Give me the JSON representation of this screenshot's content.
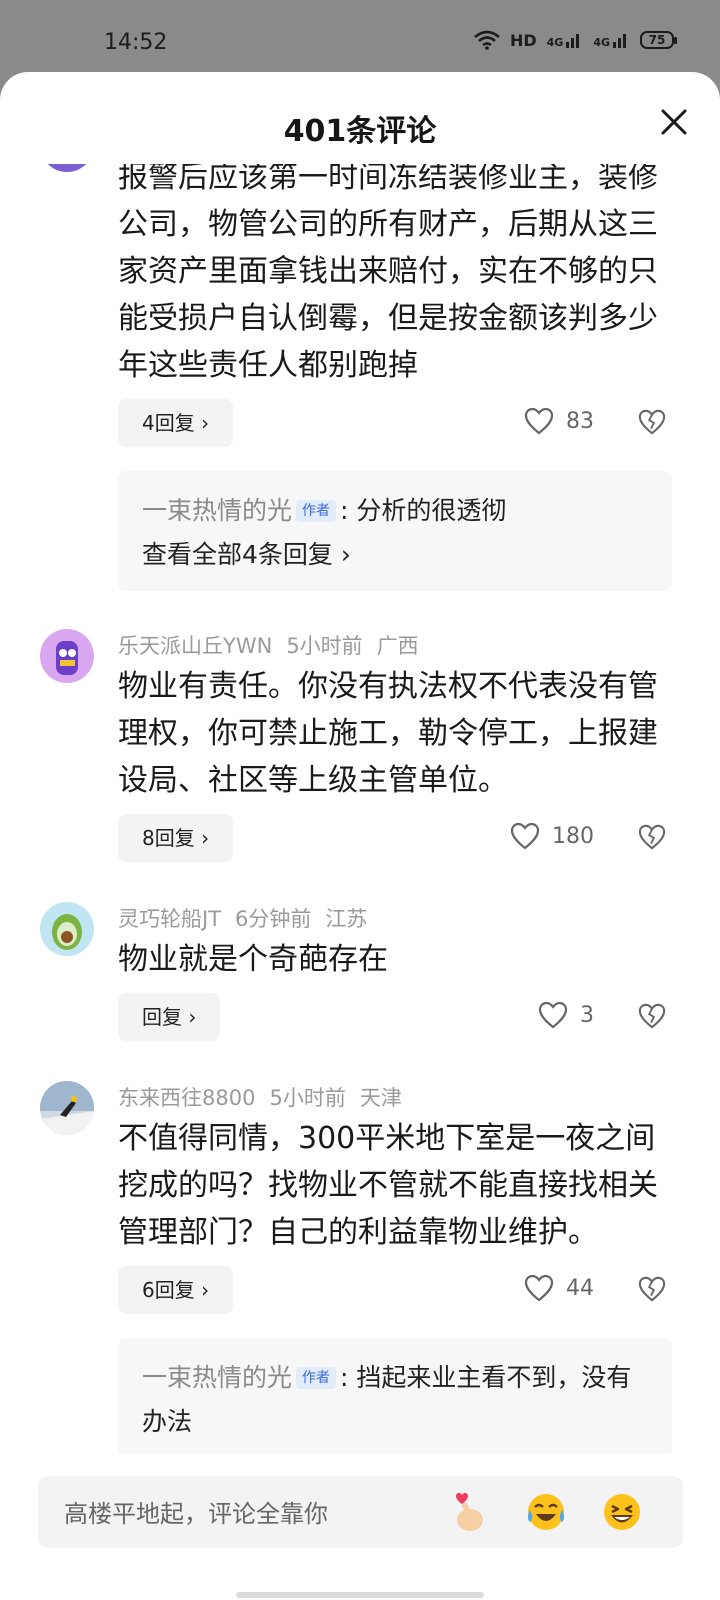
{
  "status_bar": {
    "time": "14:52",
    "network": "HD",
    "sig1": "4G",
    "sig2": "4G",
    "battery": "75"
  },
  "sheet": {
    "title": "401条评论"
  },
  "comments": [
    {
      "text": "报警后应该第一时间冻结装修业主，装修公司，物管公司的所有财产，后期从这三家资产里面拿钱出来赔付，实在不够的只能受损户自认倒霉，但是按金额该判多少年这些责任人都别跑掉",
      "reply_label": "4回复 ›",
      "likes": "83",
      "sub_replies": {
        "name": "一束热情的光",
        "badge": "作者",
        "text": ": 分析的很透彻",
        "view_all": "查看全部4条回复 ›"
      }
    },
    {
      "user": "乐天派山丘YWN",
      "time": "5小时前",
      "location": "广西",
      "text": "物业有责任。你没有执法权不代表没有管理权，你可禁止施工，勒令停工，上报建设局、社区等上级主管单位。",
      "reply_label": "8回复 ›",
      "likes": "180"
    },
    {
      "user": "灵巧轮船JT",
      "time": "6分钟前",
      "location": "江苏",
      "text": "物业就是个奇葩存在",
      "reply_label": "回复 ›",
      "likes": "3"
    },
    {
      "user": "东来西往8800",
      "time": "5小时前",
      "location": "天津",
      "text": "不值得同情，300平米地下室是一夜之间挖成的吗？找物业不管就不能直接找相关管理部门？自己的利益靠物业维护。",
      "reply_label": "6回复 ›",
      "likes": "44",
      "sub_replies": {
        "name": "一束热情的光",
        "badge": "作者",
        "text": ": 挡起来业主看不到，没有办法"
      }
    }
  ],
  "input": {
    "placeholder": "高楼平地起，评论全靠你"
  },
  "icons": [
    "wifi-icon",
    "signal-icon",
    "battery-icon",
    "close-icon",
    "heart-icon",
    "broken-heart-icon",
    "finger-heart-emoji-icon",
    "laugh-cry-emoji-icon",
    "grin-emoji-icon"
  ]
}
